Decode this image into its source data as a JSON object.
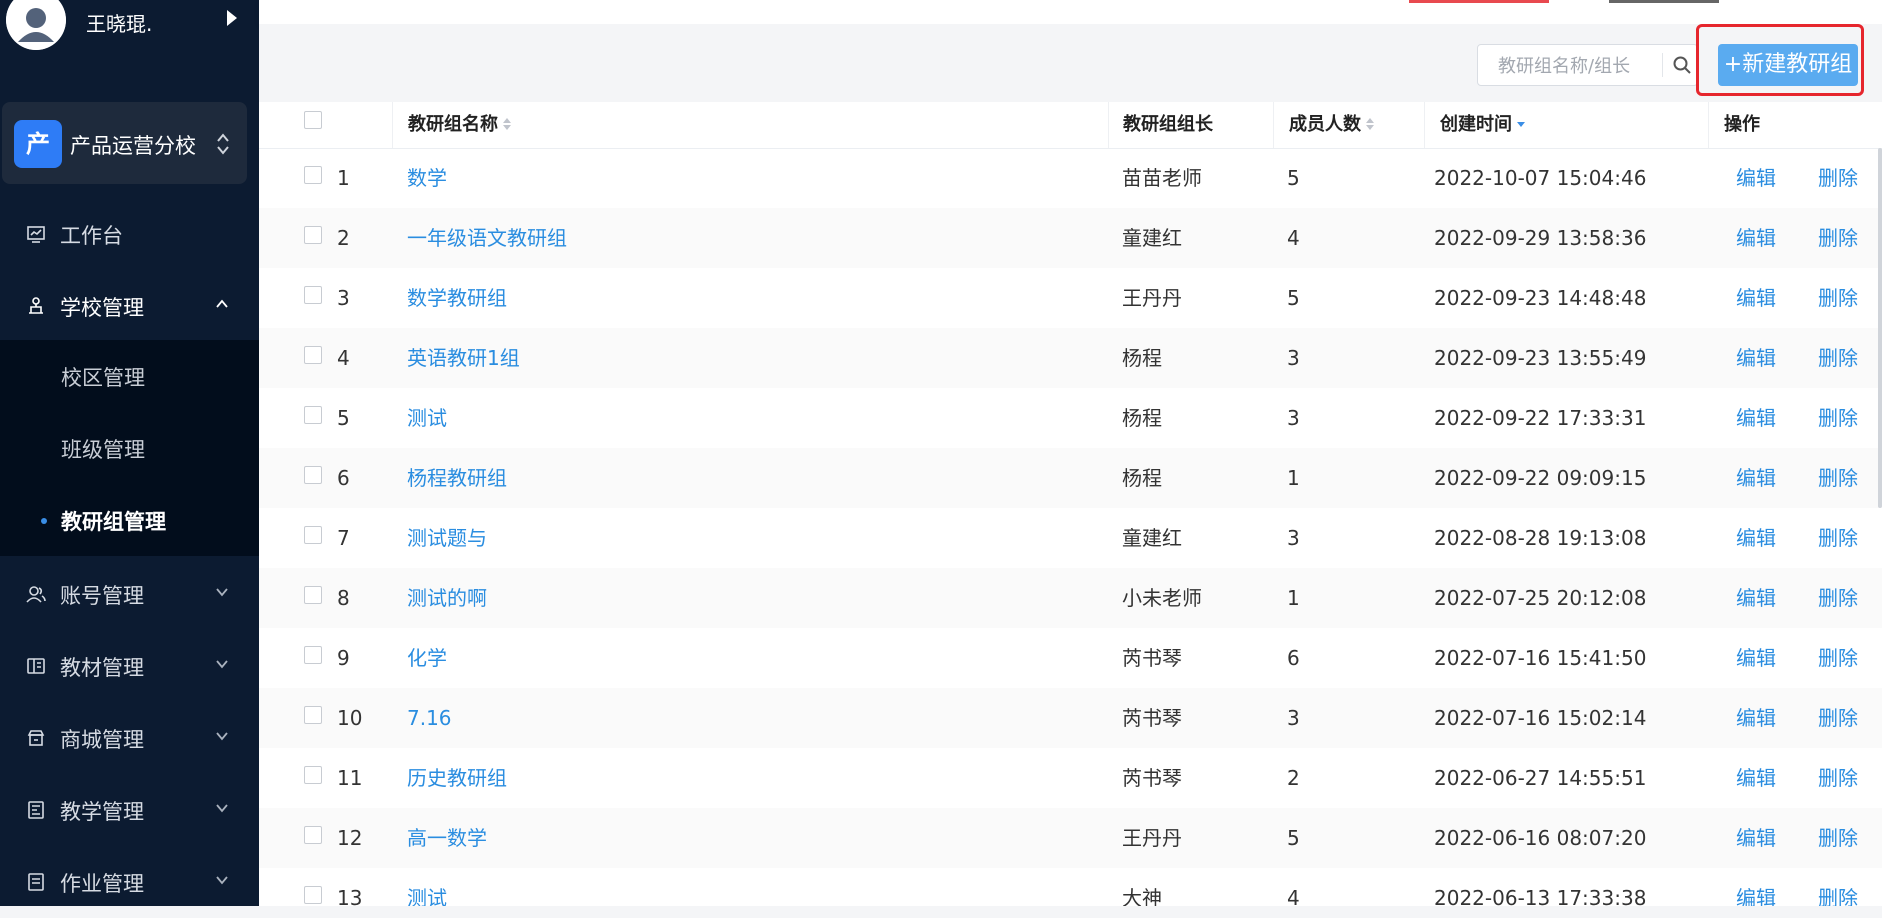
{
  "user": {
    "name": "王晓琨."
  },
  "school": {
    "logo_char": "产",
    "name": "产品运营分校"
  },
  "nav": {
    "workbench": "工作台",
    "school_mgmt": "学校管理",
    "sub": {
      "campus": "校区管理",
      "class": "班级管理",
      "group": "教研组管理"
    },
    "account": "账号管理",
    "material": "教材管理",
    "mall": "商城管理",
    "teaching": "教学管理",
    "homework": "作业管理"
  },
  "search": {
    "placeholder": "教研组名称/组长"
  },
  "actions": {
    "new_group": "+新建教研组"
  },
  "table": {
    "headers": {
      "name": "教研组名称",
      "leader": "教研组组长",
      "members": "成员人数",
      "created": "创建时间",
      "ops": "操作"
    },
    "edit_label": "编辑",
    "delete_label": "删除",
    "rows": [
      {
        "no": "1",
        "name": "数学",
        "leader": "苗苗老师",
        "members": "5",
        "created": "2022-10-07 15:04:46"
      },
      {
        "no": "2",
        "name": "一年级语文教研组",
        "leader": "童建红",
        "members": "4",
        "created": "2022-09-29 13:58:36"
      },
      {
        "no": "3",
        "name": "数学教研组",
        "leader": "王丹丹",
        "members": "5",
        "created": "2022-09-23 14:48:48"
      },
      {
        "no": "4",
        "name": "英语教研1组",
        "leader": "杨程",
        "members": "3",
        "created": "2022-09-23 13:55:49"
      },
      {
        "no": "5",
        "name": "测试",
        "leader": "杨程",
        "members": "3",
        "created": "2022-09-22 17:33:31"
      },
      {
        "no": "6",
        "name": "杨程教研组",
        "leader": "杨程",
        "members": "1",
        "created": "2022-09-22 09:09:15"
      },
      {
        "no": "7",
        "name": "测试题与",
        "leader": "童建红",
        "members": "3",
        "created": "2022-08-28 19:13:08"
      },
      {
        "no": "8",
        "name": "测试的啊",
        "leader": "小未老师",
        "members": "1",
        "created": "2022-07-25 20:12:08"
      },
      {
        "no": "9",
        "name": "化学",
        "leader": "芮书琴",
        "members": "6",
        "created": "2022-07-16 15:41:50"
      },
      {
        "no": "10",
        "name": "7.16",
        "leader": "芮书琴",
        "members": "3",
        "created": "2022-07-16 15:02:14"
      },
      {
        "no": "11",
        "name": "历史教研组",
        "leader": "芮书琴",
        "members": "2",
        "created": "2022-06-27 14:55:51"
      },
      {
        "no": "12",
        "name": "高一数学",
        "leader": "王丹丹",
        "members": "5",
        "created": "2022-06-16 08:07:20"
      },
      {
        "no": "13",
        "name": "测试",
        "leader": "大神",
        "members": "4",
        "created": "2022-06-13 17:33:38"
      }
    ]
  },
  "colors": {
    "sidebar_bg": "#0c1b31",
    "accent": "#2a8de0",
    "button_bg": "#5aabf0",
    "highlight_border": "#e6262d"
  }
}
